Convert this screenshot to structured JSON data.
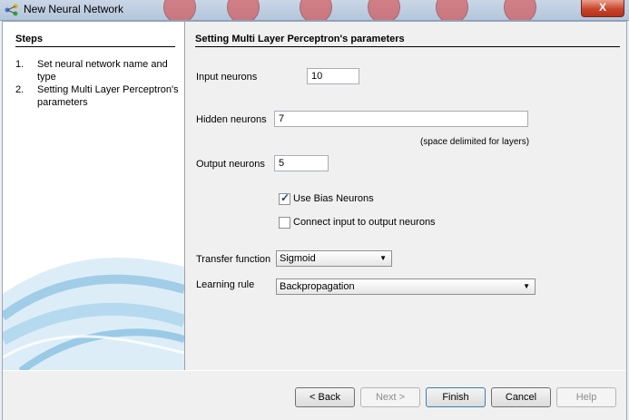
{
  "window": {
    "title": "New Neural Network",
    "close_label": "X"
  },
  "steps": {
    "header": "Steps",
    "items": [
      {
        "num": "1.",
        "label": "Set neural network name and type"
      },
      {
        "num": "2.",
        "label": "Setting Multi Layer Perceptron's parameters"
      }
    ]
  },
  "content": {
    "header": "Setting Multi Layer Perceptron's parameters",
    "input_neurons": {
      "label": "Input neurons",
      "value": "10"
    },
    "hidden_neurons": {
      "label": "Hidden neurons",
      "value": "7",
      "hint": "(space delimited for layers)"
    },
    "output_neurons": {
      "label": "Output neurons",
      "value": "5"
    },
    "use_bias": {
      "label": "Use Bias Neurons",
      "checked": true
    },
    "connect_io": {
      "label": "Connect input to output neurons",
      "checked": false
    },
    "transfer_function": {
      "label": "Transfer function",
      "selected": "Sigmoid"
    },
    "learning_rule": {
      "label": "Learning rule",
      "selected": "Backpropagation"
    }
  },
  "buttons": {
    "back": "< Back",
    "next": "Next >",
    "finish": "Finish",
    "cancel": "Cancel",
    "help": "Help"
  },
  "colors": {
    "close_button": "#c8452b",
    "steps_art": "#4a9fd0"
  }
}
